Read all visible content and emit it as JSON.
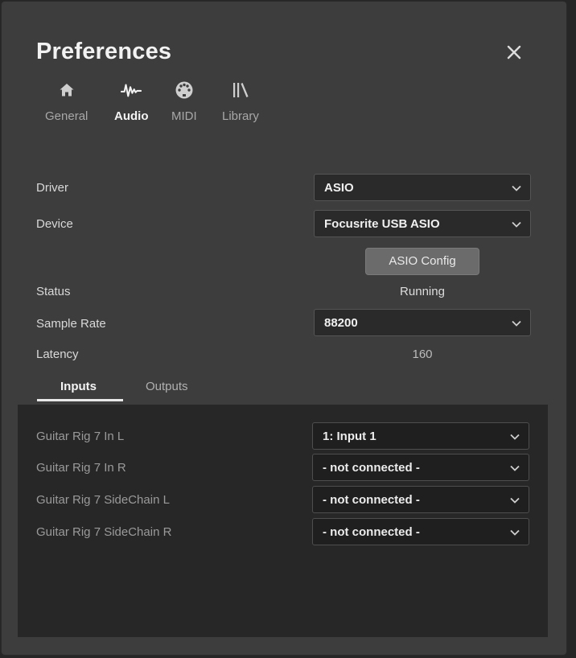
{
  "dialog": {
    "title": "Preferences"
  },
  "tabs": [
    {
      "label": "General",
      "icon": "home-icon"
    },
    {
      "label": "Audio",
      "icon": "waveform-icon",
      "active": true
    },
    {
      "label": "MIDI",
      "icon": "midi-connector-icon"
    },
    {
      "label": "Library",
      "icon": "library-icon"
    }
  ],
  "audio": {
    "driver_label": "Driver",
    "driver_value": "ASIO",
    "device_label": "Device",
    "device_value": "Focusrite USB ASIO",
    "config_button": "ASIO Config",
    "status_label": "Status",
    "status_value": "Running",
    "sample_rate_label": "Sample Rate",
    "sample_rate_value": "88200",
    "latency_label": "Latency",
    "latency_value": "160"
  },
  "io_tabs": {
    "inputs": "Inputs",
    "outputs": "Outputs",
    "active": "inputs"
  },
  "inputs": [
    {
      "label": "Guitar Rig 7 In L",
      "value": "1: Input 1"
    },
    {
      "label": "Guitar Rig 7 In R",
      "value": "- not connected -"
    },
    {
      "label": "Guitar Rig 7 SideChain L",
      "value": "- not connected -"
    },
    {
      "label": "Guitar Rig 7 SideChain R",
      "value": "- not connected -"
    }
  ],
  "colors": {
    "dialog_bg": "#3d3d3d",
    "panel_bg": "#272727",
    "accent_text": "#f4f4f4",
    "button_bg": "#6b6b6b"
  }
}
